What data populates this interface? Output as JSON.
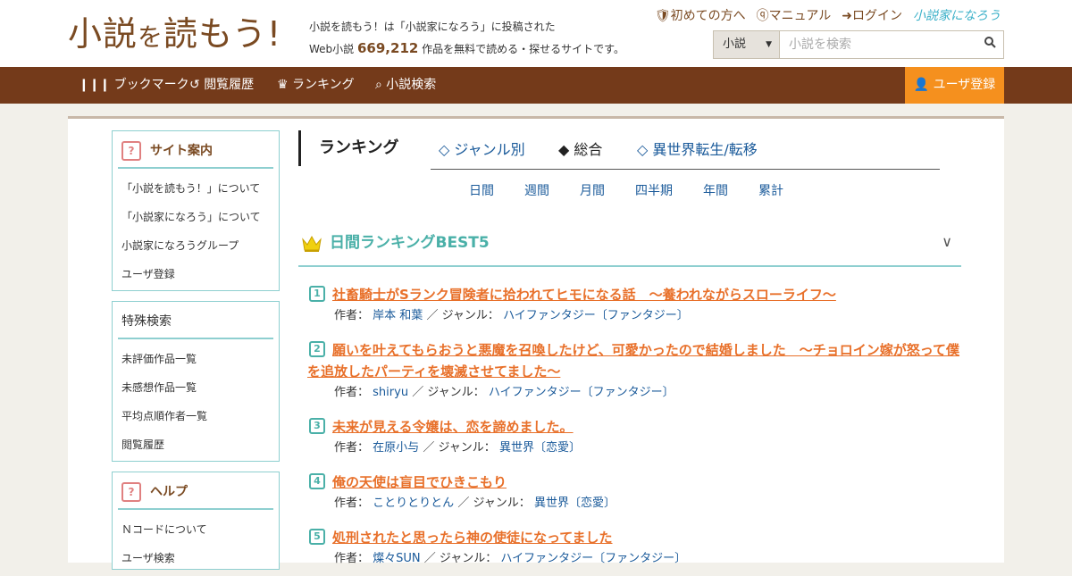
{
  "header": {
    "logo_main": "小説",
    "logo_small": "を",
    "logo_rest": "読もう!",
    "tagline_line1": "小説を読もう！は「小説家になろう」に投稿された",
    "tagline_prefix": "Web小説",
    "tagline_count": "669,212",
    "tagline_suffix": "作品を無料で読める・探せるサイトです。",
    "links": {
      "first_time": "初めての方へ",
      "manual": "マニュアル",
      "login": "ログイン",
      "brand": "小説家になろう"
    },
    "search": {
      "category": "小説",
      "placeholder": "小説を検索"
    }
  },
  "nav": {
    "bookmark": "ブックマーク",
    "history": "閲覧履歴",
    "ranking": "ランキング",
    "search": "小説検索",
    "register": "ユーザ登録"
  },
  "sidebar": {
    "site_guide": {
      "title": "サイト案内",
      "items": [
        "「小説を読もう！」について",
        "「小説家になろう」について",
        "小説家になろうグループ",
        "ユーザ登録"
      ]
    },
    "special_search": {
      "title": "特殊検索",
      "items": [
        "未評価作品一覧",
        "未感想作品一覧",
        "平均点順作者一覧",
        "閲覧履歴"
      ]
    },
    "help": {
      "title": "ヘルプ",
      "items": [
        "Ｎコードについて",
        "ユーザ検索"
      ]
    }
  },
  "ranking": {
    "title": "ランキング",
    "tabs": [
      "◇ ジャンル別",
      "◆ 総合",
      "◇ 異世界転生/転移"
    ],
    "active_tab": "◆ 総合",
    "periods": [
      "日間",
      "週間",
      "月間",
      "四半期",
      "年間",
      "累計"
    ],
    "best5_label": "日間ランキングBEST5",
    "author_label": "作者：",
    "genre_label": "／ ジャンル：",
    "entries": [
      {
        "rank": "1",
        "title": "社畜騎士がSランク冒険者に拾われてヒモになる話　～養われながらスローライフ～",
        "author": "岸本 和葉",
        "genre": "ハイファンタジー〔ファンタジー〕"
      },
      {
        "rank": "2",
        "title": "願いを叶えてもらおうと悪魔を召喚したけど、可愛かったので結婚しました　～チョロイン嫁が怒って僕を追放したパーティを壊滅させてました～",
        "author": "shiryu",
        "genre": "ハイファンタジー〔ファンタジー〕"
      },
      {
        "rank": "3",
        "title": "未来が見える令嬢は、恋を諦めました。",
        "author": "在原小与",
        "genre": "異世界〔恋愛〕"
      },
      {
        "rank": "4",
        "title": "俺の天使は盲目でひきこもり",
        "author": "ことりとりとん",
        "genre": "異世界〔恋愛〕"
      },
      {
        "rank": "5",
        "title": "処刑されたと思ったら神の使徒になってました",
        "author": "燦々SUN",
        "genre": "ハイファンタジー〔ファンタジー〕"
      }
    ]
  },
  "colors": {
    "brown": "#743a1a",
    "orange": "#f5901e",
    "teal": "#4ab0a8",
    "link_orange": "#e8702a",
    "link_blue": "#1a5a9a"
  }
}
